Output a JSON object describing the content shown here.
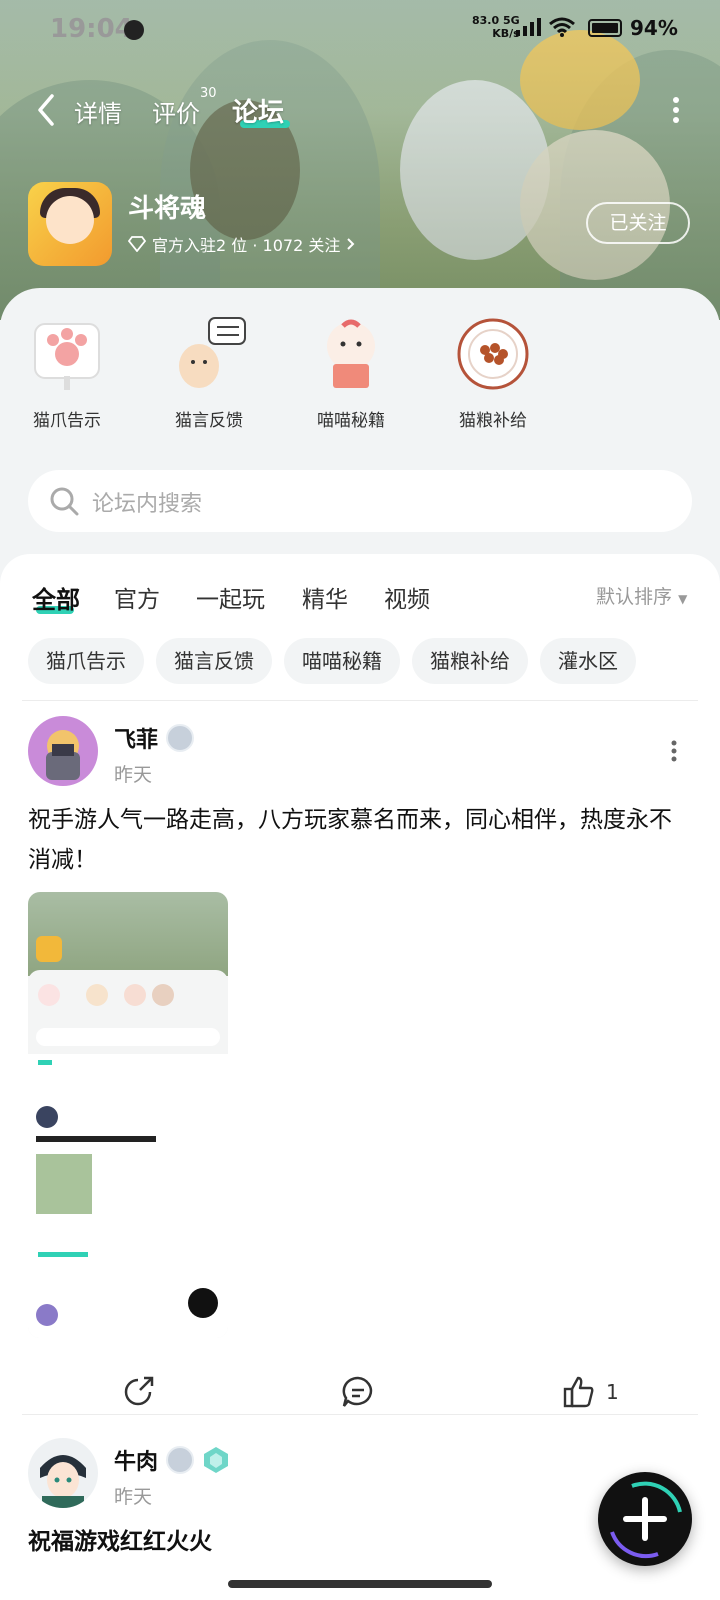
{
  "status_bar": {
    "time": "19:04",
    "net_speed_value": "83.0",
    "net_speed_unit": "KB/s",
    "network": "5G",
    "battery": "94%"
  },
  "top_tabs": [
    {
      "label": "详情"
    },
    {
      "label": "评价",
      "count": "30"
    },
    {
      "label": "论坛"
    }
  ],
  "game": {
    "name": "斗将魂",
    "meta_prefix": "官方入驻2 位 · 1072 关注",
    "follow_label": "已关注"
  },
  "categories": [
    {
      "label": "猫爪告示",
      "icon": "paw-sign-icon"
    },
    {
      "label": "猫言反馈",
      "icon": "cat-feedback-icon"
    },
    {
      "label": "喵喵秘籍",
      "icon": "cat-book-icon"
    },
    {
      "label": "猫粮补给",
      "icon": "cat-food-bowl-icon"
    }
  ],
  "search": {
    "placeholder": "论坛内搜索"
  },
  "feed_tabs": [
    {
      "label": "全部"
    },
    {
      "label": "官方"
    },
    {
      "label": "一起玩"
    },
    {
      "label": "精华"
    },
    {
      "label": "视频"
    }
  ],
  "sort_label": "默认排序",
  "chips": [
    "猫爪告示",
    "猫言反馈",
    "喵喵秘籍",
    "猫粮补给",
    "灌水区"
  ],
  "posts": [
    {
      "user": "飞菲",
      "time": "昨天",
      "text": "祝手游人气一路走高，八方玩家慕名而来，同心相伴，热度永不消减！",
      "likes": "1"
    },
    {
      "user": "牛肉",
      "time": "昨天",
      "text": "祝福游戏红红火火"
    }
  ],
  "colors": {
    "accent": "#2fd1b5"
  }
}
